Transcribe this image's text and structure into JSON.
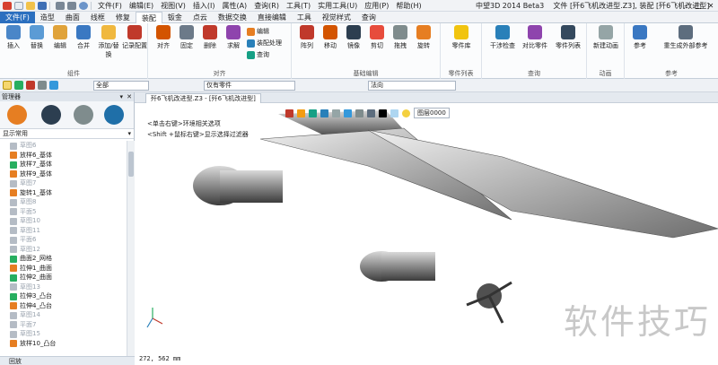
{
  "window": {
    "app_title": "中望3D 2014 Beta3",
    "file_info": "文件 [歼6飞机改进型.Z3], 装配 [歼6飞机改进型]",
    "menu": [
      "文件(F)",
      "编辑(E)",
      "视图(V)",
      "插入(I)",
      "属性(A)",
      "查询(R)",
      "工具(T)",
      "实用工具(U)",
      "应用(P)",
      "帮助(H)"
    ]
  },
  "ribbon": {
    "tabs": [
      "文件(F)",
      "造型",
      "曲面",
      "线框",
      "修复",
      "装配",
      "钣金",
      "点云",
      "数据交换",
      "直接编辑",
      "工具",
      "视觉样式",
      "查询"
    ],
    "active_tab": "装配",
    "groups": {
      "component": {
        "label": "组件",
        "buttons": [
          "插入",
          "替换",
          "编辑",
          "合并",
          "添加/替换",
          "记录配置"
        ]
      },
      "align": {
        "label": "对齐",
        "buttons": [
          "对齐",
          "固定",
          "删除",
          "求解"
        ],
        "small": [
          "编辑",
          "装配处理",
          "查询"
        ]
      },
      "basic": {
        "label": "基础编辑",
        "buttons": [
          "阵列",
          "移动",
          "镜像",
          "剪切",
          "拖拽",
          "旋转"
        ]
      },
      "parts": {
        "label": "零件列表",
        "buttons": [
          "零件库"
        ]
      },
      "query": {
        "label": "查询",
        "buttons": [
          "干涉检查",
          "对比零件",
          "零件列表"
        ]
      },
      "animation": {
        "label": "动画",
        "buttons": [
          "新建动画"
        ]
      },
      "reference": {
        "label": "参考",
        "buttons": [
          "参考",
          "重生成外部参考"
        ]
      }
    }
  },
  "toolbar": {
    "filter_combo": "全部",
    "part_filter": "仅有零件",
    "direction": "法向"
  },
  "manager": {
    "title": "管理器",
    "display_mode": "显示常用",
    "footer": "回放",
    "tree": [
      {
        "label": "草图6",
        "gray": true
      },
      {
        "label": "放样6_基体",
        "gray": false
      },
      {
        "label": "放样7_基体",
        "gray": false
      },
      {
        "label": "放样9_基体",
        "gray": false
      },
      {
        "label": "草图7",
        "gray": true
      },
      {
        "label": "旋转1_基体",
        "gray": false
      },
      {
        "label": "草图8",
        "gray": true
      },
      {
        "label": "平面5",
        "gray": true
      },
      {
        "label": "草图10",
        "gray": true
      },
      {
        "label": "草图11",
        "gray": true
      },
      {
        "label": "平面6",
        "gray": true
      },
      {
        "label": "草图12",
        "gray": true
      },
      {
        "label": "曲面2_网格",
        "gray": false
      },
      {
        "label": "拉伸1_曲面",
        "gray": false
      },
      {
        "label": "拉伸2_曲面",
        "gray": false
      },
      {
        "label": "草图13",
        "gray": true
      },
      {
        "label": "拉伸3_凸台",
        "gray": false
      },
      {
        "label": "拉伸4_凸台",
        "gray": false
      },
      {
        "label": "草图14",
        "gray": true
      },
      {
        "label": "平面7",
        "gray": true
      },
      {
        "label": "草图15",
        "gray": true
      },
      {
        "label": "放样10_凸台",
        "gray": false
      }
    ]
  },
  "document": {
    "tab_label": "歼6飞机改进型.Z3 - [歼6飞机改进型]",
    "hint_line1": "<单击右键>环境相关选项",
    "hint_line2": "<Shift +鼠标右键>显示选择过滤器",
    "layer": "图层0000",
    "coords": "272, 562 mm",
    "watermark": "软件技巧"
  },
  "colors": {
    "file_tab": "#2b6fbf",
    "accent": "#2b6fbf"
  }
}
